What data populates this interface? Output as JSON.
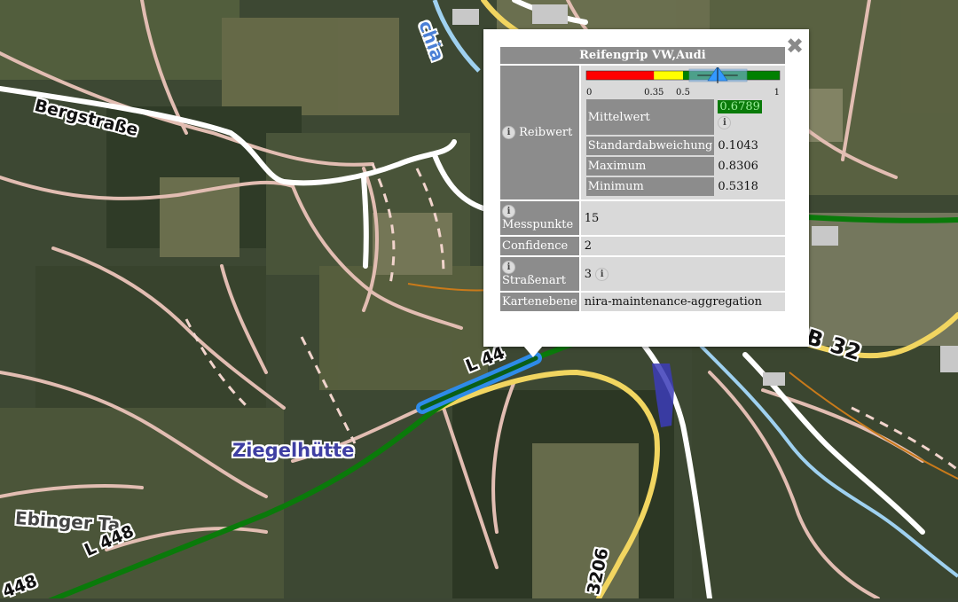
{
  "map": {
    "labels": {
      "bergstrasse": "Bergstraße",
      "ziegelhuette": "Ziegelhütte",
      "ebinger": "Ebinger Ta",
      "l448_a": "L 448",
      "l448_b": "448",
      "l44_road": "L 44",
      "b32": "B 32",
      "b3206": "3206",
      "river_top": "chia"
    },
    "colors": {
      "grip_good": "#0a7a0a",
      "highlight": "#2e8be8",
      "road_yellow": "#f1d560",
      "road_white": "#ffffff",
      "track_pink": "#e6c1b8",
      "river": "#9fd1f0"
    }
  },
  "popup": {
    "title": "Reifengrip VW,Audi",
    "close_icon": "close-icon",
    "info_glyph": "i",
    "reibwert": {
      "label": "Reibwert",
      "gauge": {
        "tick_labels": [
          "0",
          "0.35",
          "0.5",
          "1"
        ],
        "ticks": [
          0,
          0.35,
          0.5,
          1
        ],
        "zones": [
          {
            "from": 0,
            "to": 0.35,
            "color": "#ff0000"
          },
          {
            "from": 0.35,
            "to": 0.5,
            "color": "#ffff00"
          },
          {
            "from": 0.5,
            "to": 1,
            "color": "#008000"
          }
        ],
        "mean": 0.6789,
        "std": 0.1043,
        "max": 0.8306,
        "min": 0.5318,
        "marker_color": "#3399ff"
      },
      "stats": [
        {
          "label": "Mittelwert",
          "value": "0.6789",
          "highlight": true
        },
        {
          "label": "Standardabweichung",
          "value": "0.1043"
        },
        {
          "label": "Maximum",
          "value": "0.8306"
        },
        {
          "label": "Minimum",
          "value": "0.5318"
        }
      ]
    },
    "messpunkte": {
      "label": "Messpunkte",
      "value": "15"
    },
    "confidence": {
      "label": "Confidence",
      "value": "2"
    },
    "strassenart": {
      "label": "Straßenart",
      "value": "3"
    },
    "kartenebene": {
      "label": "Kartenebene",
      "value": "nira-maintenance-aggregation"
    }
  }
}
